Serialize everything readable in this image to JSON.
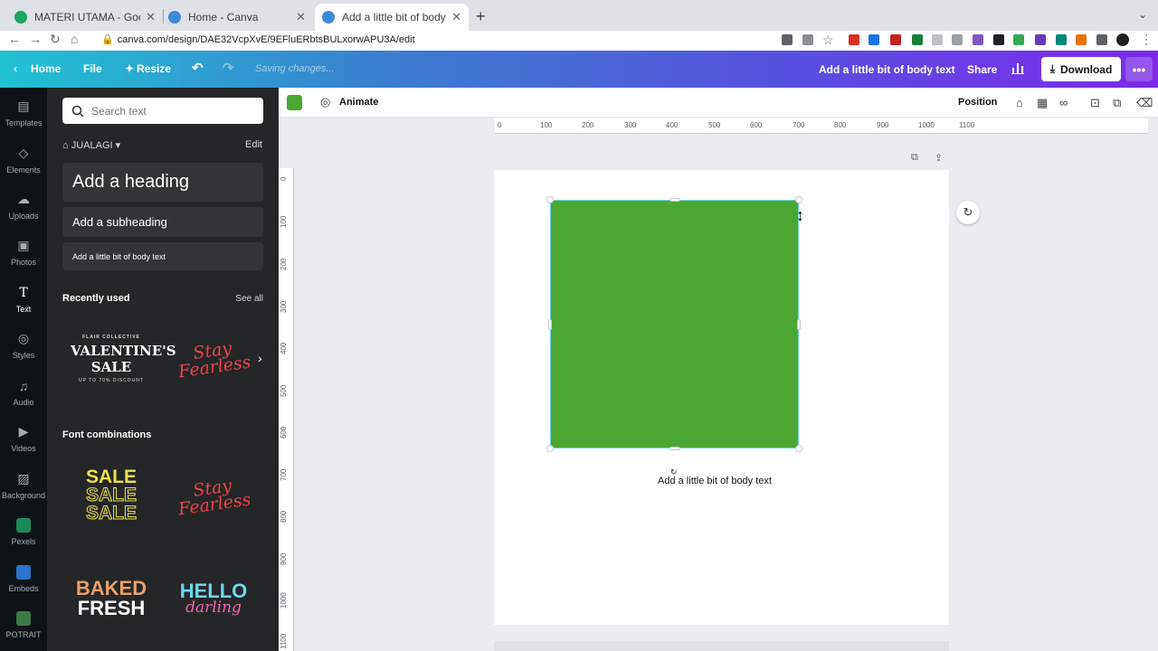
{
  "browser": {
    "tabs": [
      {
        "title": "MATERI UTAMA - Google Drive",
        "favicon_color": "#1fa463"
      },
      {
        "title": "Home - Canva",
        "favicon_color": "#3c8bd9"
      },
      {
        "title": "Add a little bit of body text - In",
        "favicon_color": "#3c8bd9"
      }
    ],
    "url": "canva.com/design/DAE32VcpXvE/9EFluERbtsBULxorwAPU3A/edit"
  },
  "topbar": {
    "home": "Home",
    "file": "File",
    "resize": "Resize",
    "status": "Saving changes...",
    "design_title": "Add a little bit of body text",
    "share": "Share",
    "download": "Download"
  },
  "rail": {
    "items": [
      {
        "label": "Templates",
        "icon": "templates-icon"
      },
      {
        "label": "Elements",
        "icon": "elements-icon"
      },
      {
        "label": "Uploads",
        "icon": "uploads-icon"
      },
      {
        "label": "Photos",
        "icon": "photos-icon"
      },
      {
        "label": "Text",
        "icon": "text-icon"
      },
      {
        "label": "Styles",
        "icon": "styles-icon"
      },
      {
        "label": "Audio",
        "icon": "audio-icon"
      },
      {
        "label": "Videos",
        "icon": "videos-icon"
      },
      {
        "label": "Background",
        "icon": "background-icon"
      },
      {
        "label": "Pexels",
        "icon": "pexels-icon"
      },
      {
        "label": "Embeds",
        "icon": "embeds-icon"
      },
      {
        "label": "POTRAIT",
        "icon": "potrait-icon"
      }
    ],
    "active": "Text",
    "app_colors": {
      "pexels": "#1a8a5a",
      "embeds": "#2877c9",
      "potrait": "#3a7a44"
    }
  },
  "panel": {
    "search_placeholder": "Search text",
    "brand_kit": "JUALAGI",
    "edit": "Edit",
    "add_heading": "Add a heading",
    "add_subheading": "Add a subheading",
    "add_body": "Add a little bit of body text",
    "recently_used": "Recently used",
    "see_all": "See all",
    "font_combinations": "Font combinations",
    "thumbs": {
      "valentine_top": "FLAIR COLLECTIVE",
      "valentine_main": "VALENTINE'S SALE",
      "valentine_sub": "UP TO 70% DISCOUNT",
      "stay_fearless": "Stay Fearless",
      "sale": "SALE",
      "baked": "BAKED",
      "fresh": "FRESH",
      "hello": "HELLO",
      "darling": "darling"
    }
  },
  "editor": {
    "fill_color": "#4aa832",
    "animate": "Animate",
    "position": "Position",
    "ruler_h": [
      "0",
      "100",
      "200",
      "300",
      "400",
      "500",
      "600",
      "700",
      "800",
      "900",
      "1000",
      "1100"
    ],
    "ruler_v": [
      "0",
      "100",
      "200",
      "300",
      "400",
      "500",
      "600",
      "700",
      "800",
      "900",
      "1000",
      "1100"
    ],
    "body_text": "Add a little bit of body text"
  },
  "colors": {
    "canva_purple": "#7d2ae8",
    "canva_teal": "#21c2d4",
    "shape_green": "#4aa832",
    "selection": "#6ed0e0"
  }
}
